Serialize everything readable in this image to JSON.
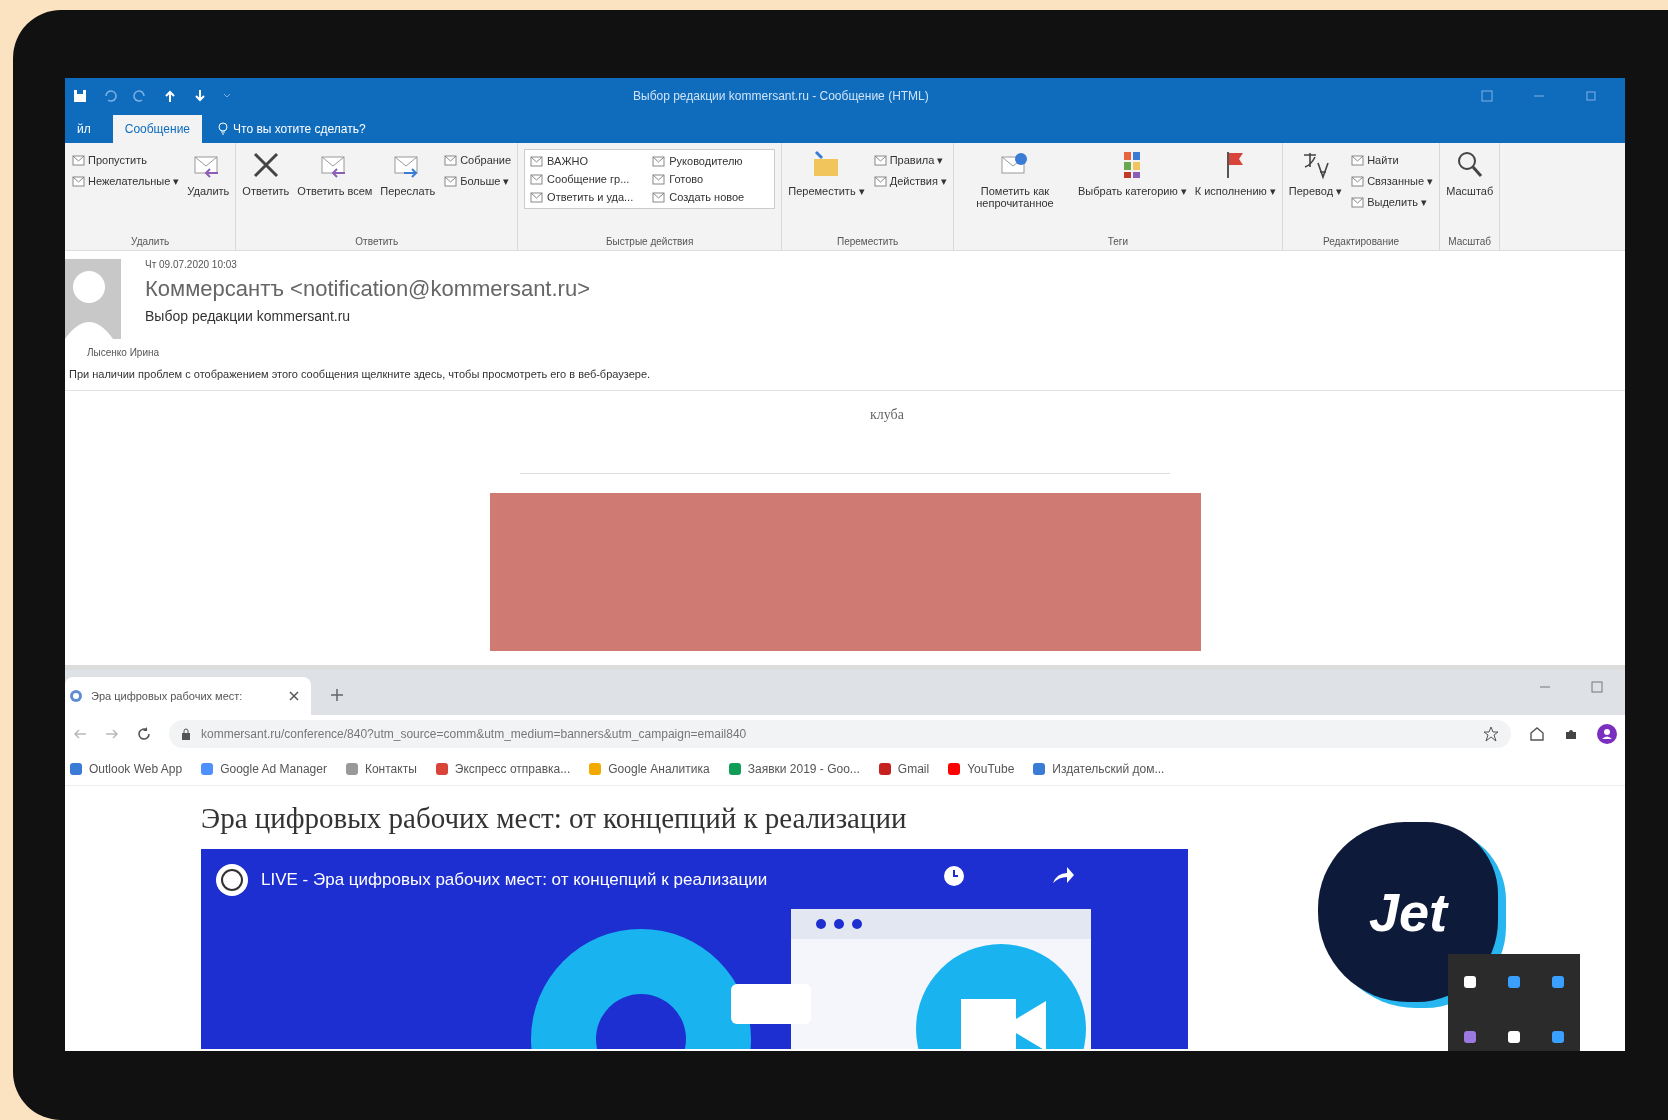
{
  "outlook": {
    "title": "Выбор редакции kommersant.ru - Сообщение (HTML)",
    "tabs": [
      {
        "label": "йл",
        "selected": false
      },
      {
        "label": "Сообщение",
        "selected": true
      }
    ],
    "tell_me": "Что вы хотите сделать?",
    "ribbon": [
      {
        "label": "Удалить",
        "items": [
          {
            "kind": "small",
            "label": "Пропустить"
          },
          {
            "kind": "small",
            "label": "Нежелательные ▾"
          },
          {
            "kind": "large",
            "label": "Удалить"
          }
        ]
      },
      {
        "label": "Ответить",
        "items": [
          {
            "kind": "large",
            "label": "Ответить"
          },
          {
            "kind": "large",
            "label": "Ответить всем"
          },
          {
            "kind": "large",
            "label": "Переслать"
          },
          {
            "kind": "small",
            "label": "Собрание"
          },
          {
            "kind": "small",
            "label": "Больше ▾"
          }
        ]
      },
      {
        "label": "Быстрые действия",
        "items": [
          {
            "kind": "quick",
            "label": "ВАЖНО"
          },
          {
            "kind": "quick",
            "label": "Сообщение гр..."
          },
          {
            "kind": "quick",
            "label": "Ответить и уда..."
          },
          {
            "kind": "quick",
            "label": "Руководителю"
          },
          {
            "kind": "quick",
            "label": "Готово"
          },
          {
            "kind": "quick",
            "label": "Создать новое"
          }
        ]
      },
      {
        "label": "Переместить",
        "items": [
          {
            "kind": "large",
            "label": "Переместить ▾"
          },
          {
            "kind": "small",
            "label": "Правила ▾"
          },
          {
            "kind": "small",
            "label": "Действия ▾"
          }
        ]
      },
      {
        "label": "Теги",
        "items": [
          {
            "kind": "large",
            "label": "Пометить как непрочитанное"
          },
          {
            "kind": "large",
            "label": "Выбрать категорию ▾"
          },
          {
            "kind": "large",
            "label": "К исполнению ▾"
          }
        ]
      },
      {
        "label": "Редактирование",
        "items": [
          {
            "kind": "large",
            "label": "Перевод ▾"
          },
          {
            "kind": "small",
            "label": "Найти"
          },
          {
            "kind": "small",
            "label": "Связанные ▾"
          },
          {
            "kind": "small",
            "label": "Выделить ▾"
          }
        ]
      },
      {
        "label": "Масштаб",
        "items": [
          {
            "kind": "large",
            "label": "Масштаб"
          }
        ]
      }
    ],
    "message": {
      "date": "Чт 09.07.2020 10:03",
      "sender": "Коммерсантъ <notification@kommersant.ru>",
      "subject": "Выбор редакции kommersant.ru",
      "recipient": "Лысенко Ирина",
      "info": "При наличии проблем с отображением этого сообщения щелкните здесь, чтобы просмотреть его в веб-браузере.",
      "body_snippet": "клуба"
    }
  },
  "browser": {
    "tab": {
      "title": "Эра цифровых рабочих мест:",
      "selected": true
    },
    "url": "kommersant.ru/conference/840?utm_source=comm&utm_medium=banners&utm_campaign=email840",
    "bookmarks": [
      "Outlook Web App",
      "Google Ad Manager",
      "Контакты",
      "Экспресс отправка...",
      "Google Аналитика",
      "Заявки 2019 - Goo...",
      "Gmail",
      "YouTube",
      "Издательский дом..."
    ],
    "page": {
      "heading": "Эра цифровых рабочих мест: от концепций к реализации",
      "video_title": "LIVE - Эра цифровых рабочих мест: от концепций к реализации",
      "ad_logo": "Jet"
    }
  }
}
